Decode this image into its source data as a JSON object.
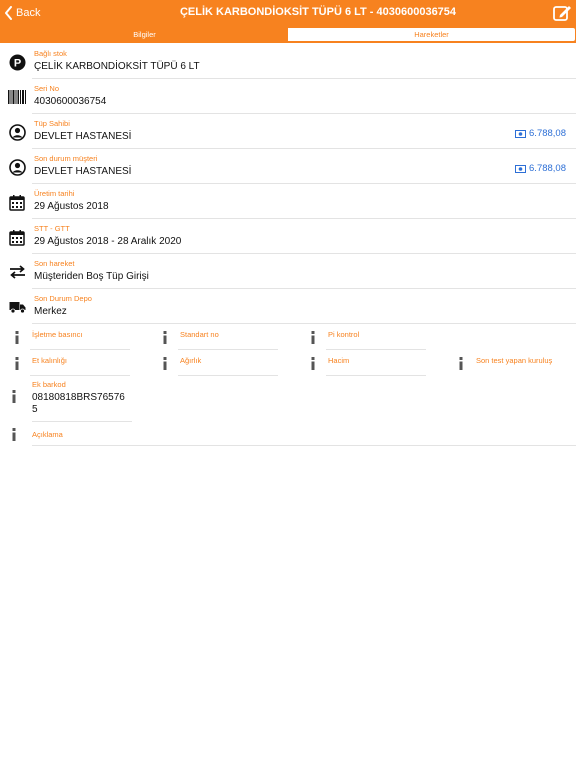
{
  "nav": {
    "back_label": "Back",
    "title": "ÇELİK KARBONDİOKSİT TÜPÜ 6 LT - 4030600036754"
  },
  "tabs": [
    {
      "label": "Bilgiler",
      "active": true
    },
    {
      "label": "Hareketler",
      "active": false
    }
  ],
  "fields": [
    {
      "icon": "parking-p-icon",
      "label": "Bağlı stok",
      "value": "ÇELİK KARBONDİOKSİT TÜPÜ 6 LT"
    },
    {
      "icon": "barcode-icon",
      "label": "Seri No",
      "value": "4030600036754"
    },
    {
      "icon": "user-circle-icon",
      "label": "Tüp Sahibi",
      "value": "DEVLET HASTANESİ",
      "amount": "6.788,08"
    },
    {
      "icon": "user-circle-icon",
      "label": "Son durum müşteri",
      "value": "DEVLET HASTANESİ",
      "amount": "6.788,08"
    },
    {
      "icon": "calendar-icon",
      "label": "Üretim tarihi",
      "value": "29 Ağustos 2018"
    },
    {
      "icon": "calendar-icon",
      "label": "STT - GTT",
      "value": "29 Ağustos 2018 - 28 Aralık 2020"
    },
    {
      "icon": "transfer-arrows-icon",
      "label": "Son hareket",
      "value": "Müşteriden Boş Tüp Girişi"
    },
    {
      "icon": "truck-icon",
      "label": "Son Durum Depo",
      "value": "Merkez"
    }
  ],
  "info_grid": [
    [
      "İşletme basıncı",
      "Standart no",
      "Pi kontrol"
    ],
    [
      "Et kalınlığı",
      "Ağırlık",
      "Hacim",
      "Son test yapan kuruluş"
    ]
  ],
  "ek_barkod": {
    "label": "Ek barkod",
    "value": "08180818BRS76576 5"
  },
  "aciklama": {
    "label": "Açıklama"
  },
  "colors": {
    "accent": "#f7821f",
    "link": "#2d6fd6"
  }
}
